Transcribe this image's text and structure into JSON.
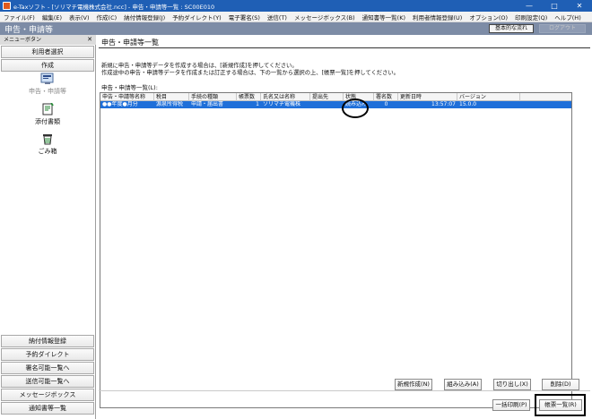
{
  "window": {
    "title": "e-Taxソフト - [ソリマチ電機株式会社.ncc] - 申告・申請等一覧 : SC00E010",
    "minimize": "—",
    "maximize": "□",
    "close": "✕"
  },
  "menu": [
    "ファイル(F)",
    "編集(E)",
    "表示(V)",
    "作成(C)",
    "納付情報登録(J)",
    "予約ダイレクト(Y)",
    "電子署名(S)",
    "送信(T)",
    "メッセージボックス(B)",
    "通知書等一覧(K)",
    "利用者情報登録(U)",
    "オプション(O)",
    "印刷設定(Q)",
    "ヘルプ(H)"
  ],
  "header": {
    "title": "申告・申請等",
    "basic_flow_label": "基本的な流れ",
    "logout_label": "ログアウト"
  },
  "sidebar": {
    "header": "メニューボタン",
    "close": "✕",
    "select_user": "利用者選択",
    "create": "作成",
    "tools": [
      {
        "label": "申告・申請等",
        "icon": "declaration-icon"
      },
      {
        "label": "添付書類",
        "icon": "attachment-icon"
      },
      {
        "label": "ごみ箱",
        "icon": "trash-icon"
      }
    ],
    "bottom_buttons": [
      "納付情報登録",
      "予約ダイレクト",
      "署名可能一覧へ",
      "送信可能一覧へ",
      "メッセージボックス",
      "通知書等一覧"
    ]
  },
  "main": {
    "section_title": "申告・申請等一覧",
    "instruction_1": "新規に申告・申請等データを作成する場合は、[新規作成]を押してください。",
    "instruction_2": "作成途中の申告・申請等データを作成または訂正する場合は、下の一覧から選択の上、[帳票一覧]を押してください。",
    "list_label": "申告・申請等一覧(L):",
    "columns": [
      "申告・申請等名称",
      "税目",
      "手続の種類",
      "帳票数",
      "氏名又は名称",
      "提出先",
      "状態",
      "署名数",
      "更新日時",
      "バージョン"
    ],
    "rows": [
      [
        "●●年度●月分",
        "源泉所得税",
        "申請・届出書",
        "1",
        "ソリマチ電機株",
        "",
        "読み込み",
        "0",
        "13:57:07",
        "15.0.0"
      ]
    ]
  },
  "actions": {
    "new": "新規作成(N)",
    "import": "組み込み(A)",
    "cutout": "切り出し(X)",
    "delete": "削除(D)",
    "batch_print": "一括印刷(P)",
    "form_list": "帳票一覧(R)"
  },
  "colors": {
    "titlebar": "#1f5fb5",
    "header": "#7d8ca6",
    "selection": "#1f6fd9"
  }
}
